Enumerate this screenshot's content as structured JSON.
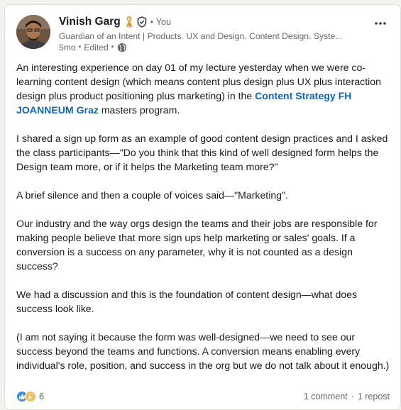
{
  "post": {
    "author": {
      "name": "Vinish Garg",
      "relation": "You",
      "headline": "Guardian of an Intent | Products. UX and Design. Content Design. Syste...",
      "time": "5mo",
      "edited": "Edited",
      "visibility_icon": "globe-icon",
      "badge_icons": [
        "ribbon-icon",
        "verified-shield-icon"
      ]
    },
    "body": {
      "p1_before": "An interesting experience on day 01 of my lecture yesterday when we were co-learning content design (which means content plus design plus UX plus interaction design plus product positioning plus marketing) in the ",
      "p1_link": "Content Strategy FH JOANNEUM Graz",
      "p1_after": " masters program.",
      "p2": "I shared a sign up form as an example of good content design practices and I asked the class participants—\"Do you think that this kind of well designed form helps the Design team more, or if it helps the Marketing team more?\"",
      "p3": "A brief silence and then a couple of voices said—\"Marketing\".",
      "p4": "Our industry and the way orgs design the teams and their jobs are responsible for making people believe that more sign ups help marketing or sales' goals. If a conversion is a success on any parameter, why it is not counted as a design success?",
      "p5": "We had a discussion and this is the foundation of content design—what does success look like.",
      "p6": "(I am not saying it because the form was well-designed—we need to see our success beyond the teams and functions. A conversion means enabling every individual's role, position, and success in the org but we do not talk about it enough.)"
    },
    "footer": {
      "reaction_icons": [
        "like-icon",
        "celebrate-icon"
      ],
      "reaction_count": "6",
      "comments": "1 comment",
      "separator": "·",
      "reposts": "1 repost"
    },
    "colors": {
      "link": "#0a66c2",
      "secondary_text": "#666666",
      "primary_text": "#191919",
      "ribbon": "#e7a33e"
    }
  }
}
